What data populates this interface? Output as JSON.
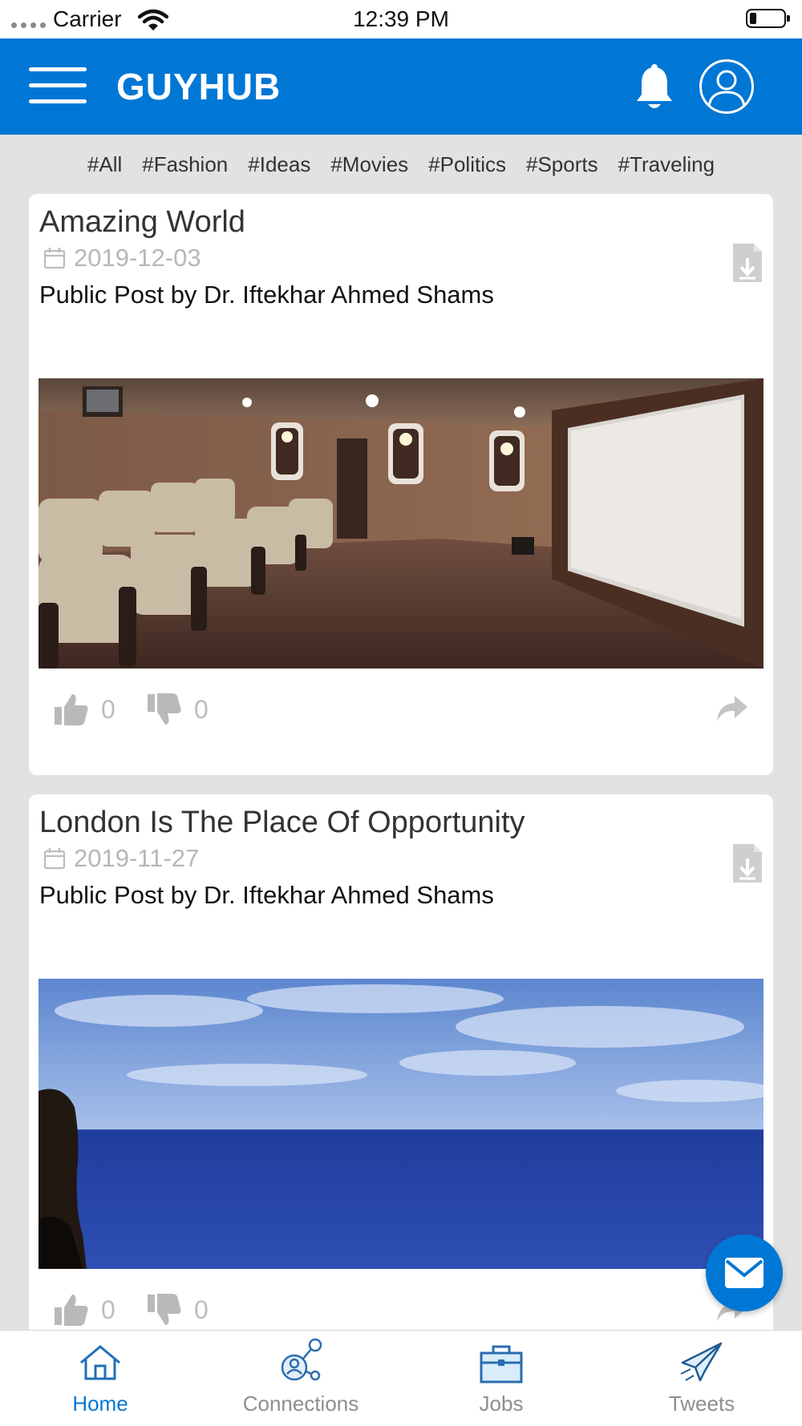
{
  "status_bar": {
    "carrier": "Carrier",
    "time": "12:39 PM"
  },
  "app_bar": {
    "title": "GUYHUB",
    "menu_icon": "hamburger-menu-icon",
    "notification_icon": "bell-icon",
    "profile_icon": "user-circle-icon"
  },
  "tags": [
    "#All",
    "#Fashion",
    "#Ideas",
    "#Movies",
    "#Politics",
    "#Sports",
    "#Traveling"
  ],
  "posts": [
    {
      "title": "Amazing World",
      "date": "2019-12-03",
      "subtitle": "Public Post by Dr. Iftekhar Ahmed Shams",
      "likes": "0",
      "dislikes": "0",
      "image": "home-theater-photo"
    },
    {
      "title": "London Is The Place Of Opportunity",
      "date": "2019-11-27",
      "subtitle": "Public Post by Dr. Iftekhar Ahmed Shams",
      "likes": "0",
      "dislikes": "0",
      "image": "ocean-sky-photo"
    }
  ],
  "fab": {
    "icon": "envelope-icon"
  },
  "tabbar": {
    "items": [
      {
        "label": "Home",
        "icon": "home-icon",
        "active": true
      },
      {
        "label": "Connections",
        "icon": "connections-icon",
        "active": false
      },
      {
        "label": "Jobs",
        "icon": "briefcase-icon",
        "active": false
      },
      {
        "label": "Tweets",
        "icon": "paper-plane-icon",
        "active": false
      }
    ]
  },
  "colors": {
    "primary": "#0077d4",
    "background": "#e2e2e2",
    "muted": "#b7b7b7"
  }
}
